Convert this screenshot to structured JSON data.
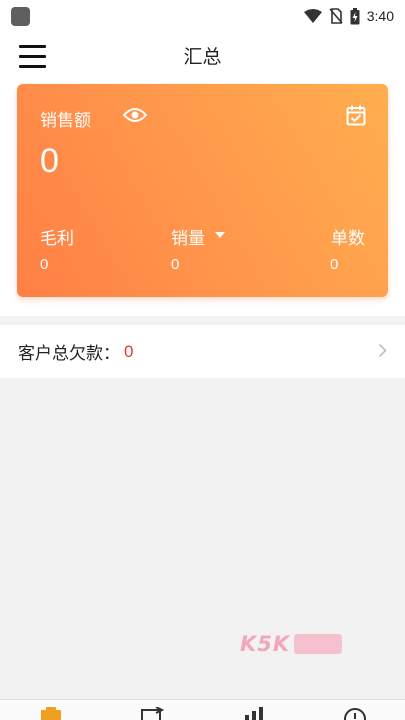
{
  "status_bar": {
    "time": "3:40"
  },
  "header": {
    "title": "汇总"
  },
  "summary_card": {
    "sales_label": "销售额",
    "sales_value": "0",
    "metrics": [
      {
        "label": "毛利",
        "value": "0"
      },
      {
        "label": "销量",
        "value": "0"
      },
      {
        "label": "单数",
        "value": "0"
      }
    ]
  },
  "debt": {
    "label": "客户总欠款：",
    "value": "0"
  },
  "watermark": {
    "text": "K5K"
  },
  "colors": {
    "card_gradient_start": "#ff7f45",
    "card_gradient_end": "#ffae4f",
    "debt_value": "#e53935",
    "nav_active": "#f0a020"
  }
}
